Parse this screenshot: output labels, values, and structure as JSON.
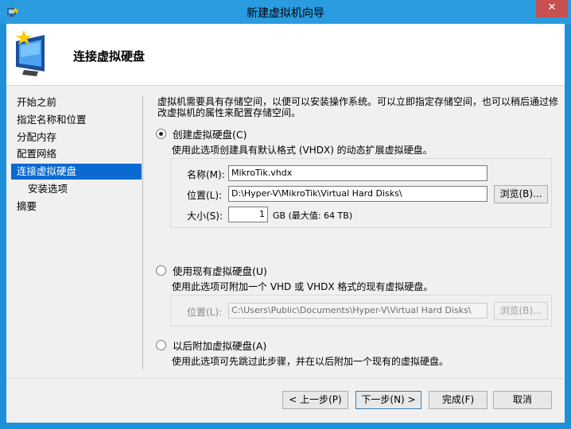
{
  "window": {
    "title": "新建虚拟机向导",
    "close_label": "✕"
  },
  "header": {
    "title": "连接虚拟硬盘"
  },
  "nav": {
    "items": [
      {
        "label": "开始之前"
      },
      {
        "label": "指定名称和位置"
      },
      {
        "label": "分配内存"
      },
      {
        "label": "配置网络"
      },
      {
        "label": "连接虚拟硬盘"
      },
      {
        "label": "安装选项"
      },
      {
        "label": "摘要"
      }
    ],
    "active_index": 4
  },
  "content": {
    "description": "虚拟机需要具有存储空间，以便可以安装操作系统。可以立即指定存储空间，也可以稍后通过修改虚拟机的属性来配置存储空间。",
    "option_create": {
      "label": "创建虚拟硬盘(C)",
      "desc": "使用此选项创建具有默认格式 (VHDX) 的动态扩展虚拟硬盘。",
      "name_label": "名称(M):",
      "name_value": "MikroTik.vhdx",
      "location_label": "位置(L):",
      "location_value": "D:\\Hyper-V\\MikroTik\\Virtual Hard Disks\\",
      "browse_label": "浏览(B)...",
      "size_label": "大小(S):",
      "size_value": "1",
      "size_unit": "GB (最大值: 64 TB)"
    },
    "option_existing": {
      "label": "使用现有虚拟硬盘(U)",
      "desc": "使用此选项可附加一个 VHD 或 VHDX 格式的现有虚拟硬盘。",
      "location_label": "位置(L):",
      "location_value": "C:\\Users\\Public\\Documents\\Hyper-V\\Virtual Hard Disks\\",
      "browse_label": "浏览(B)..."
    },
    "option_later": {
      "label": "以后附加虚拟硬盘(A)",
      "desc": "使用此选项可先跳过此步骤，并在以后附加一个现有的虚拟硬盘。"
    },
    "selected_option": "create"
  },
  "footer": {
    "prev_label": "< 上一步(P)",
    "next_label": "下一步(N) >",
    "finish_label": "完成(F)",
    "cancel_label": "取消"
  },
  "colors": {
    "titlebar": "#2b9be0",
    "nav_active": "#0a6ad2",
    "close_button": "#c75050"
  }
}
